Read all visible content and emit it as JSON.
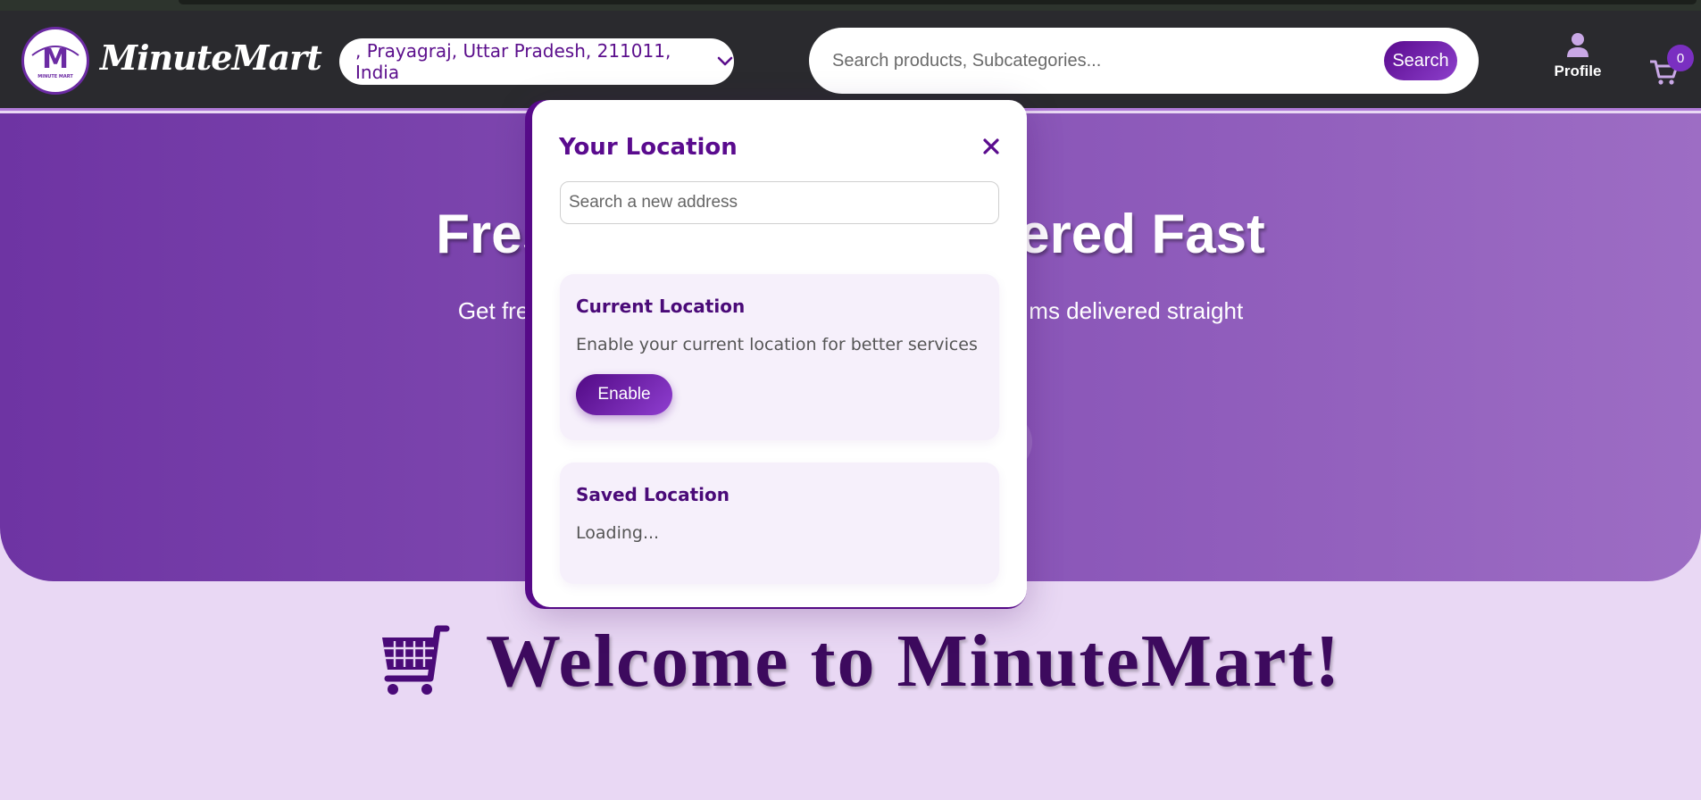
{
  "app": {
    "brand": "MinuteMart",
    "logo_letter": "M",
    "logo_caption": "MINUTE MART"
  },
  "header": {
    "location": ", Prayagraj, Uttar Pradesh, 211011, India",
    "search_placeholder": "Search products, Subcategories...",
    "search_button": "Search",
    "profile_label": "Profile",
    "cart_count": "0"
  },
  "hero": {
    "title_left": "Fres",
    "title_right": "ered Fast",
    "subtitle_left": "Get fre",
    "subtitle_right": "ms delivered straight"
  },
  "welcome": {
    "text": "Welcome to MinuteMart!"
  },
  "modal": {
    "title": "Your Location",
    "close_icon": "close-icon",
    "address_placeholder": "Search a new address",
    "current": {
      "title": "Current Location",
      "text": "Enable your current location for better services",
      "button": "Enable"
    },
    "saved": {
      "title": "Saved Location",
      "status": "Loading..."
    }
  },
  "colors": {
    "accent": "#5a0b8e",
    "navbar": "#2a2a2e",
    "hero_start": "#6e34a3",
    "hero_end": "#9d6dc4",
    "page_bg": "#e9d8f4"
  }
}
